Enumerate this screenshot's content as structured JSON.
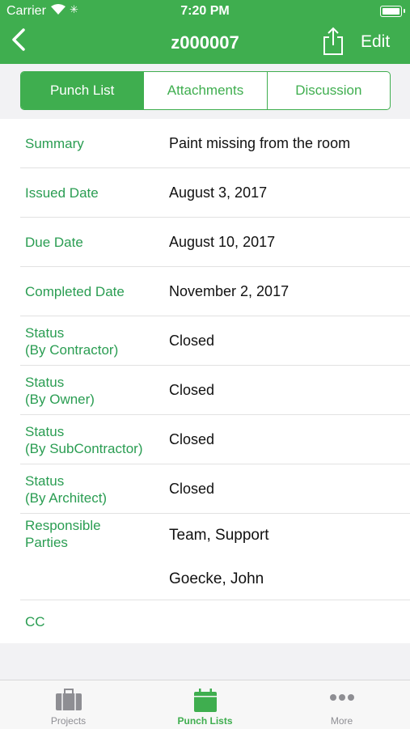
{
  "status_bar": {
    "carrier": "Carrier",
    "time": "7:20 PM"
  },
  "nav": {
    "title": "z000007",
    "edit_label": "Edit"
  },
  "segments": [
    "Punch List",
    "Attachments",
    "Discussion"
  ],
  "fields": {
    "summary_label": "Summary",
    "summary_value": "Paint missing from the room",
    "issued_label": "Issued Date",
    "issued_value": "August 3, 2017",
    "due_label": "Due Date",
    "due_value": "August 10, 2017",
    "completed_label": "Completed Date",
    "completed_value": "November 2, 2017",
    "status_contractor_label": [
      "Status",
      "(By Contractor)"
    ],
    "status_contractor_value": "Closed",
    "status_owner_label": [
      "Status",
      "(By Owner)"
    ],
    "status_owner_value": "Closed",
    "status_sub_label": [
      "Status",
      "(By SubContractor)"
    ],
    "status_sub_value": "Closed",
    "status_architect_label": [
      "Status",
      "(By Architect)"
    ],
    "status_architect_value": "Closed",
    "responsible_label": [
      "Responsible",
      "Parties"
    ],
    "responsible_values": [
      "Team, Support",
      "Goecke, John"
    ],
    "cc_label": "CC"
  },
  "tabbar": {
    "items": [
      "Projects",
      "Punch Lists",
      "More"
    ]
  },
  "colors": {
    "accent": "#3fae4f",
    "label_green": "#2a9d52",
    "inactive_gray": "#8e8e93"
  }
}
